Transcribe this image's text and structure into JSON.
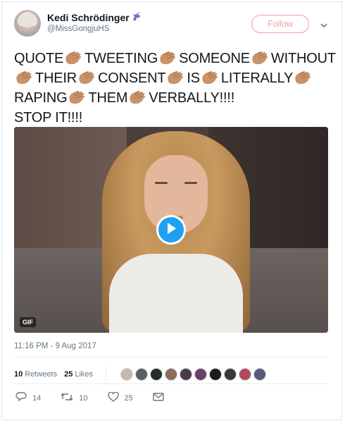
{
  "author": {
    "display_name": "Kedi Schrödinger",
    "badge_icon": "unicorn-icon",
    "handle": "@MissGongjuHS"
  },
  "follow_label": "Follow",
  "tweet": {
    "segments": [
      "QUOTE",
      "TWEETING",
      "SOMEONE",
      "WITHOUT",
      "THEIR",
      "CONSENT",
      "IS",
      "LITERALLY",
      "RAPING",
      "THEM",
      "VERBALLY!!!!"
    ],
    "tail": "STOP IT!!!!",
    "separator_icon": "clap-emoji"
  },
  "media": {
    "type_badge": "GIF",
    "play_icon": "play-icon"
  },
  "timestamp": "11:16 PM - 9 Aug 2017",
  "stats": {
    "retweets_count": "10",
    "retweets_label": "Retweets",
    "likes_count": "25",
    "likes_label": "Likes"
  },
  "actions": {
    "reply_count": "14",
    "retweet_count": "10",
    "like_count": "25"
  },
  "colors": {
    "accent": "#1da1f2",
    "follow_outline": "#e8a4a4"
  }
}
